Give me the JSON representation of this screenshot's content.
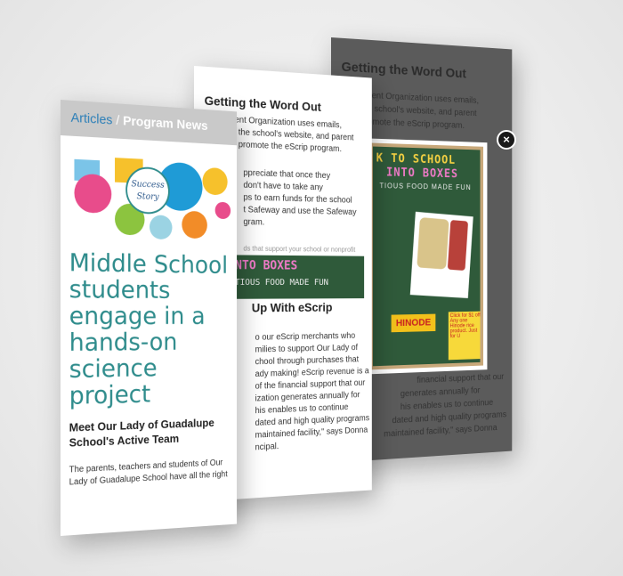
{
  "back_panel": {
    "heading": "Getting the Word Out",
    "line1": "The Parent Organization uses emails,",
    "line2": "the school's website, and parent",
    "line3": "promote the eScrip program.",
    "lower1": "financial support that our",
    "lower2": "generates annually for",
    "lower3": "his enables us to continue",
    "lower4": "dated and high quality programs",
    "lower5": "maintained facility,\" says Donna",
    "lightbox": {
      "title1": "K TO SCHOOL",
      "title2": "INTO BOXES",
      "title3": "TIOUS FOOD MADE FUN",
      "brand": "HINODE",
      "coupon_text": "Click for $1 off! Any one Hinode rice product. Just for U"
    },
    "close_label": "×"
  },
  "mid_panel": {
    "heading": "Getting the Word Out",
    "p1a": "The Parent Organization uses emails,",
    "p1b": "the school's website, and parent",
    "p1c": "promote the eScrip program.",
    "p2a": "ppreciate that once they",
    "p2b": "don't have to take any",
    "p2c": "ps to earn funds for the school",
    "p2d": "t Safeway and use the Safeway",
    "p2e": "gram.",
    "small": "ds that support your school or nonprofit",
    "banner1": "NTO BOXES",
    "banner2": "TIOUS FOOD MADE FUN",
    "heading2": "Up With eScrip",
    "p3a": "o our eScrip merchants who",
    "p3b": "milies to support Our Lady of",
    "p3c": "chool through purchases that",
    "p3d": "ady making! eScrip revenue is a",
    "p3e": "of the financial support that our",
    "p3f": "ization generates annually for",
    "p3g": "his enables us to continue",
    "p3h": "dated and high quality programs",
    "p3i": "maintained facility,\" says Donna",
    "p3j": "ncipal."
  },
  "front_panel": {
    "breadcrumb_link": "Articles",
    "breadcrumb_sep": " / ",
    "breadcrumb_current": "Program News",
    "badge_line1": "Success",
    "badge_line2": "Story",
    "title": "Middle School students engage in a hands-on science project",
    "subhead": "Meet Our Lady of Guadalupe School's Active Team",
    "body": "The parents, teachers and students of Our Lady of Guadalupe School have all the right"
  },
  "colors": {
    "title_teal": "#2f8c8c",
    "link_blue": "#2c7fb8",
    "chalkboard": "#2f5a3a"
  }
}
